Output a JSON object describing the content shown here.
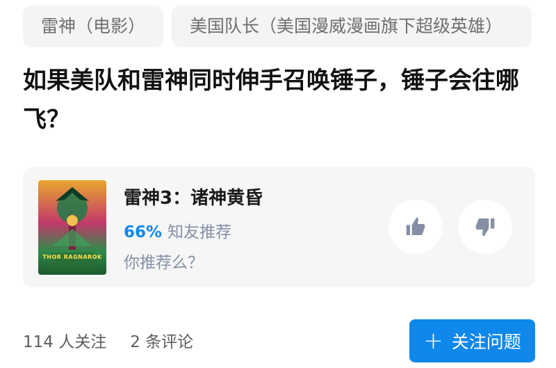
{
  "tags": [
    "雷神（电影）",
    "美国队长（美国漫威漫画旗下超级英雄）"
  ],
  "question": {
    "title": "如果美队和雷神同时伸手召唤锤子，锤子会往哪飞？"
  },
  "movie_card": {
    "poster_text": "THOR RAGNAROK",
    "title": "雷神3：诸神黄昏",
    "rating_percent": "66%",
    "rating_label": "知友推荐",
    "prompt": "你推荐么？"
  },
  "footer": {
    "followers": "114 人关注",
    "comments": "2 条评论",
    "follow_button_label": "关注问题"
  },
  "icons": {
    "upvote": "thumb-up-icon",
    "downvote": "thumb-down-icon",
    "follow": "plus-icon"
  },
  "colors": {
    "accent": "#0f88eb",
    "tag_bg": "#f3f4f6",
    "card_bg": "#f6f6f6"
  }
}
